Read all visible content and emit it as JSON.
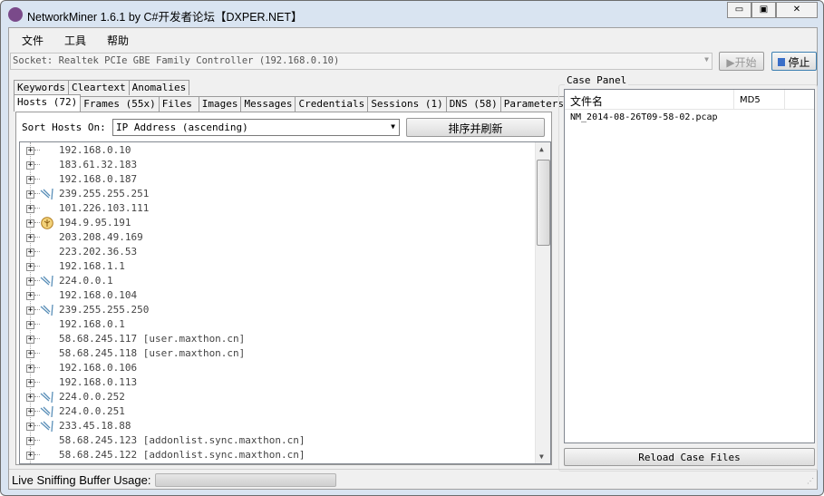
{
  "window": {
    "title": "NetworkMiner 1.6.1 by C#开发者论坛【DXPER.NET】",
    "minimize": "▭",
    "maximize": "▣",
    "close": "✕"
  },
  "menu": [
    "文件",
    "工具",
    "帮助"
  ],
  "socket": {
    "value": "Socket: Realtek PCIe GBE Family Controller (192.168.0.10)",
    "start": "▶开始",
    "stop": "停止"
  },
  "tabs_row1": [
    "Keywords",
    "Cleartext",
    "Anomalies"
  ],
  "tabs_row2": [
    "Hosts (72)",
    "Frames (55x)",
    "Files",
    "Images",
    "Messages",
    "Credentials",
    "Sessions (1)",
    "DNS (58)",
    "Parameters"
  ],
  "active_tab": "Hosts (72)",
  "sort": {
    "label": "Sort Hosts On:",
    "value": "IP Address (ascending)",
    "button": "排序并刷新"
  },
  "hosts": [
    {
      "ip": "192.168.0.10",
      "icon": ""
    },
    {
      "ip": "183.61.32.183",
      "icon": ""
    },
    {
      "ip": "192.168.0.187",
      "icon": ""
    },
    {
      "ip": "239.255.255.251",
      "icon": "multicast-icon"
    },
    {
      "ip": "101.226.103.111",
      "icon": ""
    },
    {
      "ip": "194.9.95.191",
      "icon": "router-icon"
    },
    {
      "ip": "203.208.49.169",
      "icon": ""
    },
    {
      "ip": "223.202.36.53",
      "icon": ""
    },
    {
      "ip": "192.168.1.1",
      "icon": ""
    },
    {
      "ip": "224.0.0.1",
      "icon": "multicast-icon"
    },
    {
      "ip": "192.168.0.104",
      "icon": ""
    },
    {
      "ip": "239.255.255.250",
      "icon": "multicast-icon"
    },
    {
      "ip": "192.168.0.1",
      "icon": ""
    },
    {
      "ip": "58.68.245.117 [user.maxthon.cn]",
      "icon": ""
    },
    {
      "ip": "58.68.245.118 [user.maxthon.cn]",
      "icon": ""
    },
    {
      "ip": "192.168.0.106",
      "icon": ""
    },
    {
      "ip": "192.168.0.113",
      "icon": ""
    },
    {
      "ip": "224.0.0.252",
      "icon": "multicast-icon"
    },
    {
      "ip": "224.0.0.251",
      "icon": "multicast-icon"
    },
    {
      "ip": "233.45.18.88",
      "icon": "multicast-icon"
    },
    {
      "ip": "58.68.245.123 [addonlist.sync.maxthon.cn]",
      "icon": ""
    },
    {
      "ip": "58.68.245.122 [addonlist.sync.maxthon.cn]",
      "icon": ""
    }
  ],
  "case_panel": {
    "title": "Case Panel",
    "columns": [
      "文件名",
      "MD5"
    ],
    "files": [
      "NM_2014-08-26T09-58-02.pcap"
    ],
    "reload": "Reload Case Files"
  },
  "status": {
    "label": "Live Sniffing Buffer Usage:",
    "buffer_usage_percent": 0
  }
}
